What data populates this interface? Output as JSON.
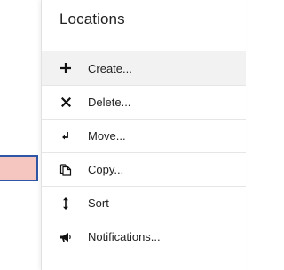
{
  "menu": {
    "title": "Locations",
    "items": [
      {
        "label": "Create...",
        "icon": "plus-icon"
      },
      {
        "label": "Delete...",
        "icon": "x-icon"
      },
      {
        "label": "Move...",
        "icon": "move-arrow-icon"
      },
      {
        "label": "Copy...",
        "icon": "copy-icon"
      },
      {
        "label": "Sort",
        "icon": "sort-arrows-icon"
      },
      {
        "label": "Notifications...",
        "icon": "megaphone-icon"
      }
    ]
  },
  "colors": {
    "selected_fill": "#f5c5c0",
    "selected_border": "#2f56a6",
    "hover_bg": "#f2f2f2"
  }
}
